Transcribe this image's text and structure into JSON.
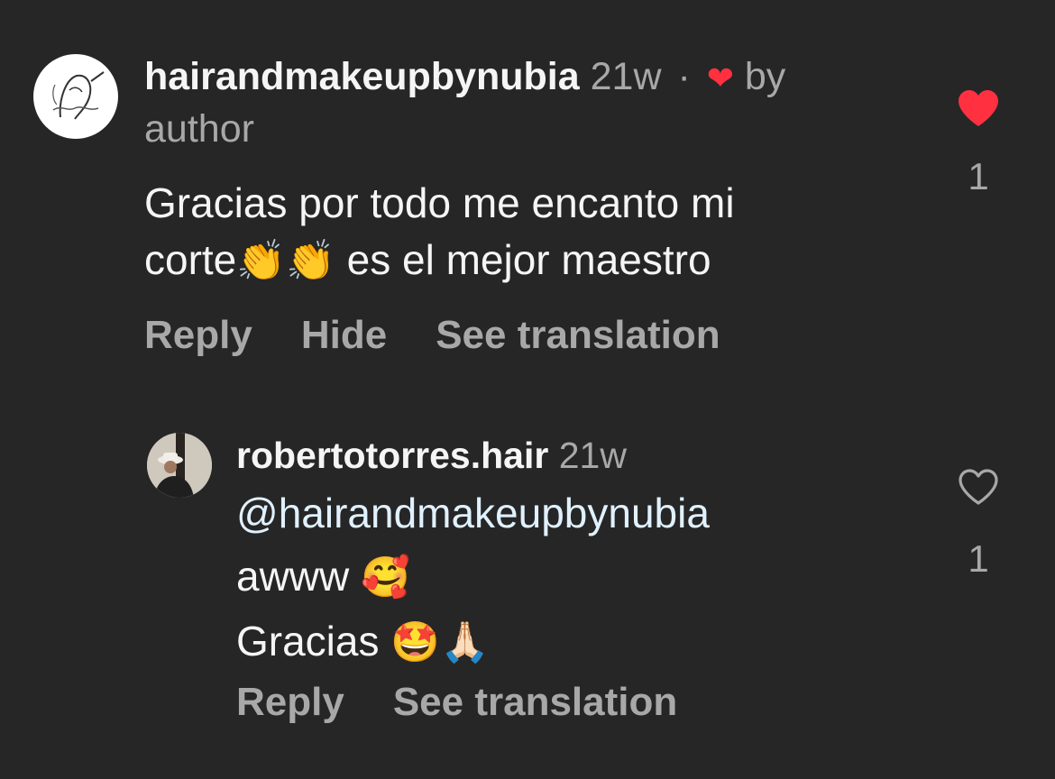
{
  "comments": [
    {
      "username": "hairandmakeupbynubia",
      "time": "21w",
      "separator": "·",
      "liked_by_label": "by",
      "liked_by_value": "author",
      "text_line1": "Gracias por todo  me encanto mi",
      "text_line2_start": "corte",
      "text_line2_emoji": "👏👏",
      "text_line2_end": "es el mejor maestro",
      "actions": {
        "reply": "Reply",
        "hide": "Hide",
        "see_translation": "See translation"
      },
      "like_count": "1",
      "liked": true
    },
    {
      "username": "robertotorres.hair",
      "time": "21w",
      "mention": "@hairandmakeupbynubia",
      "line2_text": "awww",
      "line2_emoji": "🥰",
      "line3_text": "Gracias",
      "line3_emoji": "🤩🙏🏻",
      "actions": {
        "reply": "Reply",
        "see_translation": "See translation"
      },
      "like_count": "1",
      "liked": false
    }
  ],
  "colors": {
    "background": "#262626",
    "like_red": "#ff3040",
    "muted": "#a8a8a8",
    "mention": "#e0f1ff"
  }
}
